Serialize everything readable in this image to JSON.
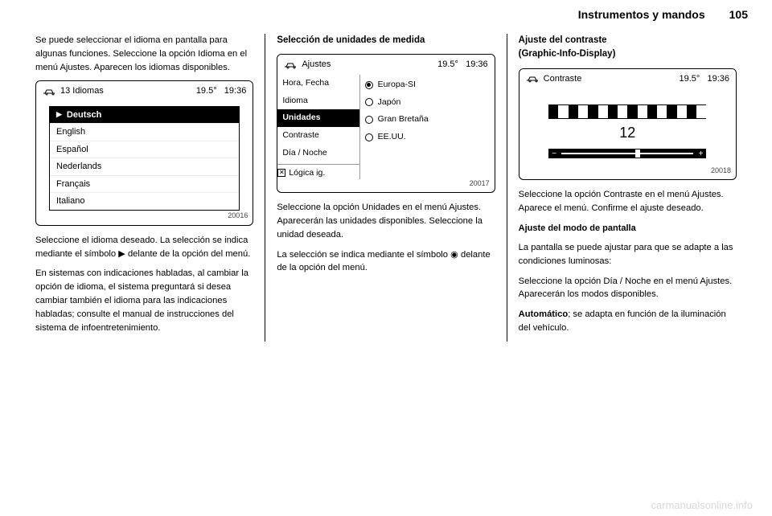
{
  "header": {
    "title": "Instrumentos y mandos",
    "page": "105"
  },
  "col1": {
    "intro": "Se puede seleccionar el idioma en pantalla para algunas funciones. Seleccione la opción Idioma en el menú Ajustes. Aparecen los idiomas disponibles.",
    "screen": {
      "left": "13 Idiomas",
      "temp": "19.5°",
      "time": "19:36",
      "items": [
        "Deutsch",
        "English",
        "Español",
        "Nederlands",
        "Français",
        "Italiano"
      ],
      "imgnum": "20016"
    },
    "p2": "Seleccione el idioma deseado. La selección se indica mediante el símbolo ▶ delante de la opción del menú.",
    "p3": "En sistemas con indicaciones habladas, al cambiar la opción de idioma, el sistema preguntará si desea cambiar también el idioma para las indicaciones habladas; consulte el manual de instrucciones del sistema de infoentretenimiento."
  },
  "col2": {
    "heading": "Selección de unidades de medida",
    "screen": {
      "title": "Ajustes",
      "temp": "19.5°",
      "time": "19:36",
      "menu": [
        "Hora, Fecha",
        "Idioma",
        "Unidades",
        "Contraste",
        "Día / Noche"
      ],
      "menu_sel": "Unidades",
      "check_label": "Lógica ig.",
      "options": [
        "Europa-SI",
        "Japón",
        "Gran Bretaña",
        "EE.UU."
      ],
      "option_sel": "Europa-SI",
      "imgnum": "20017"
    },
    "p1": "Seleccione la opción Unidades en el menú Ajustes. Aparecerán las unidades disponibles. Seleccione la unidad deseada.",
    "p2": "La selección se indica mediante el símbolo ◉ delante de la opción del menú."
  },
  "col3": {
    "heading1": "Ajuste del contraste",
    "heading2": "(Graphic-Info-Display)",
    "screen": {
      "title": "Contraste",
      "temp": "19.5°",
      "time": "19:36",
      "value": "12",
      "imgnum": "20018"
    },
    "p1": "Seleccione la opción Contraste en el menú Ajustes. Aparece el menú. Confirme el ajuste deseado.",
    "sub2": "Ajuste del modo de pantalla",
    "p2": "La pantalla se puede ajustar para que se adapte a las condiciones luminosas:",
    "p3": "Seleccione la opción Día / Noche en el menú Ajustes. Aparecerán los modos disponibles.",
    "p4a": "Automático",
    "p4b": "; se adapta en función de la iluminación del vehículo."
  },
  "footer": "carmanualsonline.info"
}
